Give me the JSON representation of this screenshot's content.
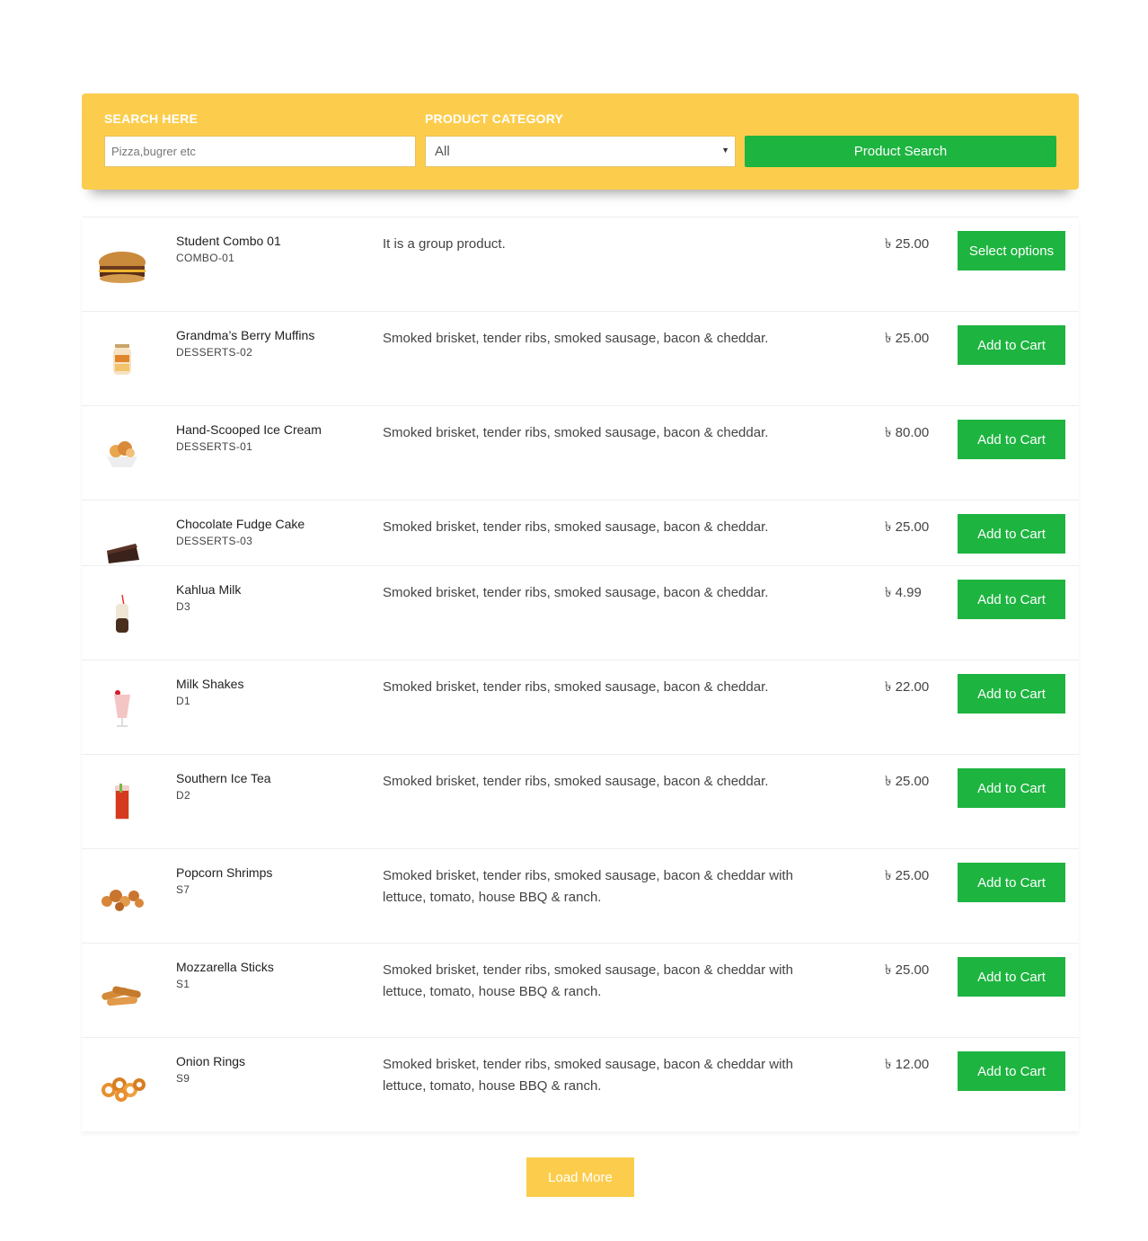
{
  "search": {
    "label": "SEARCH HERE",
    "placeholder": "Pizza,bugrer etc",
    "category_label": "PRODUCT CATEGORY",
    "category_selected": "All",
    "button_label": "Product Search"
  },
  "products": [
    {
      "name": "Student Combo 01",
      "sku": "COMBO-01",
      "desc": "It is a group product.",
      "price": "৳ 25.00",
      "button": "Select options",
      "icon": "burger-icon"
    },
    {
      "name": "Grandma’s Berry Muffins",
      "sku": "DESSERTS-02",
      "desc": "Smoked brisket, tender ribs, smoked sausage, bacon & cheddar.",
      "price": "৳ 25.00",
      "button": "Add to Cart",
      "icon": "dessert-jar-icon"
    },
    {
      "name": "Hand-Scooped Ice Cream",
      "sku": "DESSERTS-01",
      "desc": "Smoked brisket, tender ribs, smoked sausage, bacon & cheddar.",
      "price": "৳ 80.00",
      "button": "Add to Cart",
      "icon": "ice-cream-bowl-icon"
    },
    {
      "name": "Chocolate Fudge Cake",
      "sku": "DESSERTS-03",
      "desc": "Smoked brisket, tender ribs, smoked sausage, bacon & cheddar.",
      "price": "৳ 25.00",
      "button": "Add to Cart",
      "icon": "cake-slice-icon"
    },
    {
      "name": "Kahlua Milk",
      "sku": "D3",
      "desc": "Smoked brisket, tender ribs, smoked sausage, bacon & cheddar.",
      "price": "৳ 4.99",
      "button": "Add to Cart",
      "icon": "milk-drink-icon"
    },
    {
      "name": "Milk Shakes",
      "sku": "D1",
      "desc": "Smoked brisket, tender ribs, smoked sausage, bacon & cheddar.",
      "price": "৳ 22.00",
      "button": "Add to Cart",
      "icon": "milkshake-icon"
    },
    {
      "name": "Southern Ice Tea",
      "sku": "D2",
      "desc": "Smoked brisket, tender ribs, smoked sausage, bacon & cheddar.",
      "price": "৳ 25.00",
      "button": "Add to Cart",
      "icon": "iced-tea-icon"
    },
    {
      "name": "Popcorn Shrimps",
      "sku": "S7",
      "desc": "Smoked brisket, tender ribs, smoked sausage, bacon & cheddar with lettuce, tomato, house BBQ & ranch.",
      "price": "৳ 25.00",
      "button": "Add to Cart",
      "icon": "popcorn-shrimp-icon"
    },
    {
      "name": "Mozzarella Sticks",
      "sku": "S1",
      "desc": "Smoked brisket, tender ribs, smoked sausage, bacon & cheddar with lettuce, tomato, house BBQ & ranch.",
      "price": "৳ 25.00",
      "button": "Add to Cart",
      "icon": "mozzarella-sticks-icon"
    },
    {
      "name": "Onion Rings",
      "sku": "S9",
      "desc": "Smoked brisket, tender ribs, smoked sausage, bacon & cheddar with lettuce, tomato, house BBQ & ranch.",
      "price": "৳ 12.00",
      "button": "Add to Cart",
      "icon": "onion-rings-icon"
    }
  ],
  "load_more_label": "Load More",
  "colors": {
    "accent_yellow": "#fccd4d",
    "accent_green": "#1db440"
  }
}
